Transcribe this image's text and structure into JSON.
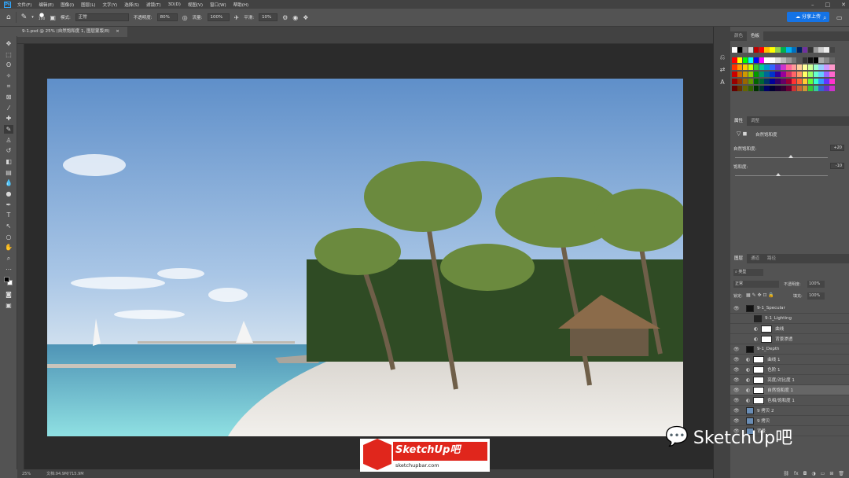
{
  "menubar": {
    "app_icon": "Ps",
    "items": [
      "文件(F)",
      "编辑(E)",
      "图像(I)",
      "图层(L)",
      "文字(Y)",
      "选择(S)",
      "滤镜(T)",
      "3D(D)",
      "视图(V)",
      "窗口(W)",
      "帮助(H)"
    ]
  },
  "optionsbar": {
    "brush_size": "100",
    "mode_label": "模式:",
    "mode_value": "正常",
    "opacity_label": "不透明度:",
    "opacity_value": "80%",
    "flow_label": "流量:",
    "flow_value": "100%",
    "smooth_label": "平滑:",
    "smooth_value": "10%",
    "share_label": "分享上传"
  },
  "document": {
    "tab_title": "9-1.psd @ 25% (自然饱和度 1, 图层蒙版/8)",
    "zoom": "25%",
    "doc_size": "文档:94.9M/715.9M"
  },
  "panels": {
    "color_tabs": [
      "颜色",
      "色板"
    ],
    "properties_tabs": [
      "属性",
      "调整"
    ],
    "properties_title": "自然饱和度",
    "vibrance_label": "自然饱和度:",
    "vibrance_value": "+20",
    "vibrance_level": 0.6,
    "saturation_label": "饱和度:",
    "saturation_value": "-10",
    "saturation_level": 0.47,
    "layers_tabs": [
      "图层",
      "通道",
      "路径"
    ],
    "kind_filter": "类型",
    "blend_mode": "正常",
    "opacity_label": "不透明度:",
    "opacity_value": "100%",
    "lock_label": "锁定:",
    "fill_label": "填充:",
    "fill_value": "100%",
    "layers": [
      {
        "name": "9-1_Specular",
        "visible": true
      },
      {
        "name": "9-1_Lighting",
        "visible": false
      },
      {
        "name": "曲线",
        "visible": false
      },
      {
        "name": "背景渗透",
        "visible": false
      },
      {
        "name": "9-1_Depth",
        "visible": true
      },
      {
        "name": "曲线 1",
        "visible": true
      },
      {
        "name": "色阶 1",
        "visible": true
      },
      {
        "name": "亮度/对比度 1",
        "visible": true
      },
      {
        "name": "自然饱和度 1",
        "visible": true
      },
      {
        "name": "色相/饱和度 1",
        "visible": true
      },
      {
        "name": "9 拷贝 2",
        "visible": true
      },
      {
        "name": "9 拷贝",
        "visible": true
      },
      {
        "name": "背景",
        "visible": true
      }
    ]
  },
  "watermarks": {
    "logo_text": "SketchUp吧",
    "logo_url": "sketchupbar.com",
    "wechat_text": "SketchUp吧"
  },
  "colors": {
    "accent": "#31a8ff",
    "share_button": "#1473e6",
    "logo_red": "#e0261c"
  }
}
